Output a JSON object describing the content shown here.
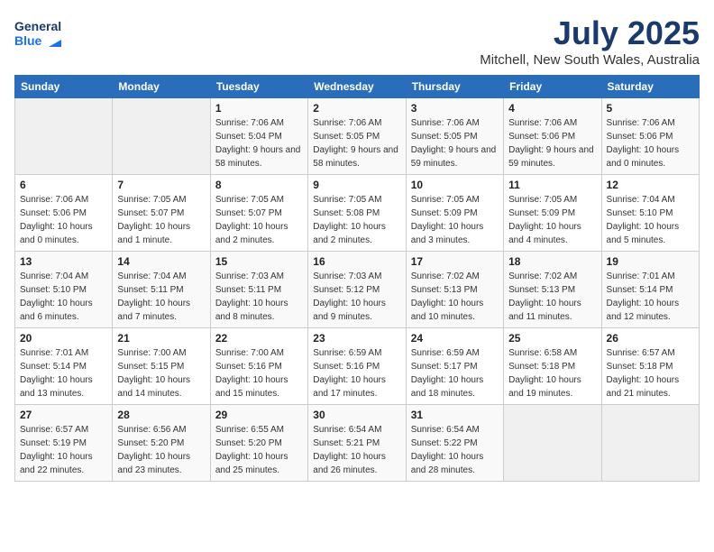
{
  "app": {
    "logo_line1": "General",
    "logo_line2": "Blue",
    "title": "July 2025",
    "subtitle": "Mitchell, New South Wales, Australia"
  },
  "calendar": {
    "headers": [
      "Sunday",
      "Monday",
      "Tuesday",
      "Wednesday",
      "Thursday",
      "Friday",
      "Saturday"
    ],
    "weeks": [
      [
        {
          "day": "",
          "info": ""
        },
        {
          "day": "",
          "info": ""
        },
        {
          "day": "1",
          "info": "Sunrise: 7:06 AM\nSunset: 5:04 PM\nDaylight: 9 hours and 58 minutes."
        },
        {
          "day": "2",
          "info": "Sunrise: 7:06 AM\nSunset: 5:05 PM\nDaylight: 9 hours and 58 minutes."
        },
        {
          "day": "3",
          "info": "Sunrise: 7:06 AM\nSunset: 5:05 PM\nDaylight: 9 hours and 59 minutes."
        },
        {
          "day": "4",
          "info": "Sunrise: 7:06 AM\nSunset: 5:06 PM\nDaylight: 9 hours and 59 minutes."
        },
        {
          "day": "5",
          "info": "Sunrise: 7:06 AM\nSunset: 5:06 PM\nDaylight: 10 hours and 0 minutes."
        }
      ],
      [
        {
          "day": "6",
          "info": "Sunrise: 7:06 AM\nSunset: 5:06 PM\nDaylight: 10 hours and 0 minutes."
        },
        {
          "day": "7",
          "info": "Sunrise: 7:05 AM\nSunset: 5:07 PM\nDaylight: 10 hours and 1 minute."
        },
        {
          "day": "8",
          "info": "Sunrise: 7:05 AM\nSunset: 5:07 PM\nDaylight: 10 hours and 2 minutes."
        },
        {
          "day": "9",
          "info": "Sunrise: 7:05 AM\nSunset: 5:08 PM\nDaylight: 10 hours and 2 minutes."
        },
        {
          "day": "10",
          "info": "Sunrise: 7:05 AM\nSunset: 5:09 PM\nDaylight: 10 hours and 3 minutes."
        },
        {
          "day": "11",
          "info": "Sunrise: 7:05 AM\nSunset: 5:09 PM\nDaylight: 10 hours and 4 minutes."
        },
        {
          "day": "12",
          "info": "Sunrise: 7:04 AM\nSunset: 5:10 PM\nDaylight: 10 hours and 5 minutes."
        }
      ],
      [
        {
          "day": "13",
          "info": "Sunrise: 7:04 AM\nSunset: 5:10 PM\nDaylight: 10 hours and 6 minutes."
        },
        {
          "day": "14",
          "info": "Sunrise: 7:04 AM\nSunset: 5:11 PM\nDaylight: 10 hours and 7 minutes."
        },
        {
          "day": "15",
          "info": "Sunrise: 7:03 AM\nSunset: 5:11 PM\nDaylight: 10 hours and 8 minutes."
        },
        {
          "day": "16",
          "info": "Sunrise: 7:03 AM\nSunset: 5:12 PM\nDaylight: 10 hours and 9 minutes."
        },
        {
          "day": "17",
          "info": "Sunrise: 7:02 AM\nSunset: 5:13 PM\nDaylight: 10 hours and 10 minutes."
        },
        {
          "day": "18",
          "info": "Sunrise: 7:02 AM\nSunset: 5:13 PM\nDaylight: 10 hours and 11 minutes."
        },
        {
          "day": "19",
          "info": "Sunrise: 7:01 AM\nSunset: 5:14 PM\nDaylight: 10 hours and 12 minutes."
        }
      ],
      [
        {
          "day": "20",
          "info": "Sunrise: 7:01 AM\nSunset: 5:14 PM\nDaylight: 10 hours and 13 minutes."
        },
        {
          "day": "21",
          "info": "Sunrise: 7:00 AM\nSunset: 5:15 PM\nDaylight: 10 hours and 14 minutes."
        },
        {
          "day": "22",
          "info": "Sunrise: 7:00 AM\nSunset: 5:16 PM\nDaylight: 10 hours and 15 minutes."
        },
        {
          "day": "23",
          "info": "Sunrise: 6:59 AM\nSunset: 5:16 PM\nDaylight: 10 hours and 17 minutes."
        },
        {
          "day": "24",
          "info": "Sunrise: 6:59 AM\nSunset: 5:17 PM\nDaylight: 10 hours and 18 minutes."
        },
        {
          "day": "25",
          "info": "Sunrise: 6:58 AM\nSunset: 5:18 PM\nDaylight: 10 hours and 19 minutes."
        },
        {
          "day": "26",
          "info": "Sunrise: 6:57 AM\nSunset: 5:18 PM\nDaylight: 10 hours and 21 minutes."
        }
      ],
      [
        {
          "day": "27",
          "info": "Sunrise: 6:57 AM\nSunset: 5:19 PM\nDaylight: 10 hours and 22 minutes."
        },
        {
          "day": "28",
          "info": "Sunrise: 6:56 AM\nSunset: 5:20 PM\nDaylight: 10 hours and 23 minutes."
        },
        {
          "day": "29",
          "info": "Sunrise: 6:55 AM\nSunset: 5:20 PM\nDaylight: 10 hours and 25 minutes."
        },
        {
          "day": "30",
          "info": "Sunrise: 6:54 AM\nSunset: 5:21 PM\nDaylight: 10 hours and 26 minutes."
        },
        {
          "day": "31",
          "info": "Sunrise: 6:54 AM\nSunset: 5:22 PM\nDaylight: 10 hours and 28 minutes."
        },
        {
          "day": "",
          "info": ""
        },
        {
          "day": "",
          "info": ""
        }
      ]
    ]
  }
}
